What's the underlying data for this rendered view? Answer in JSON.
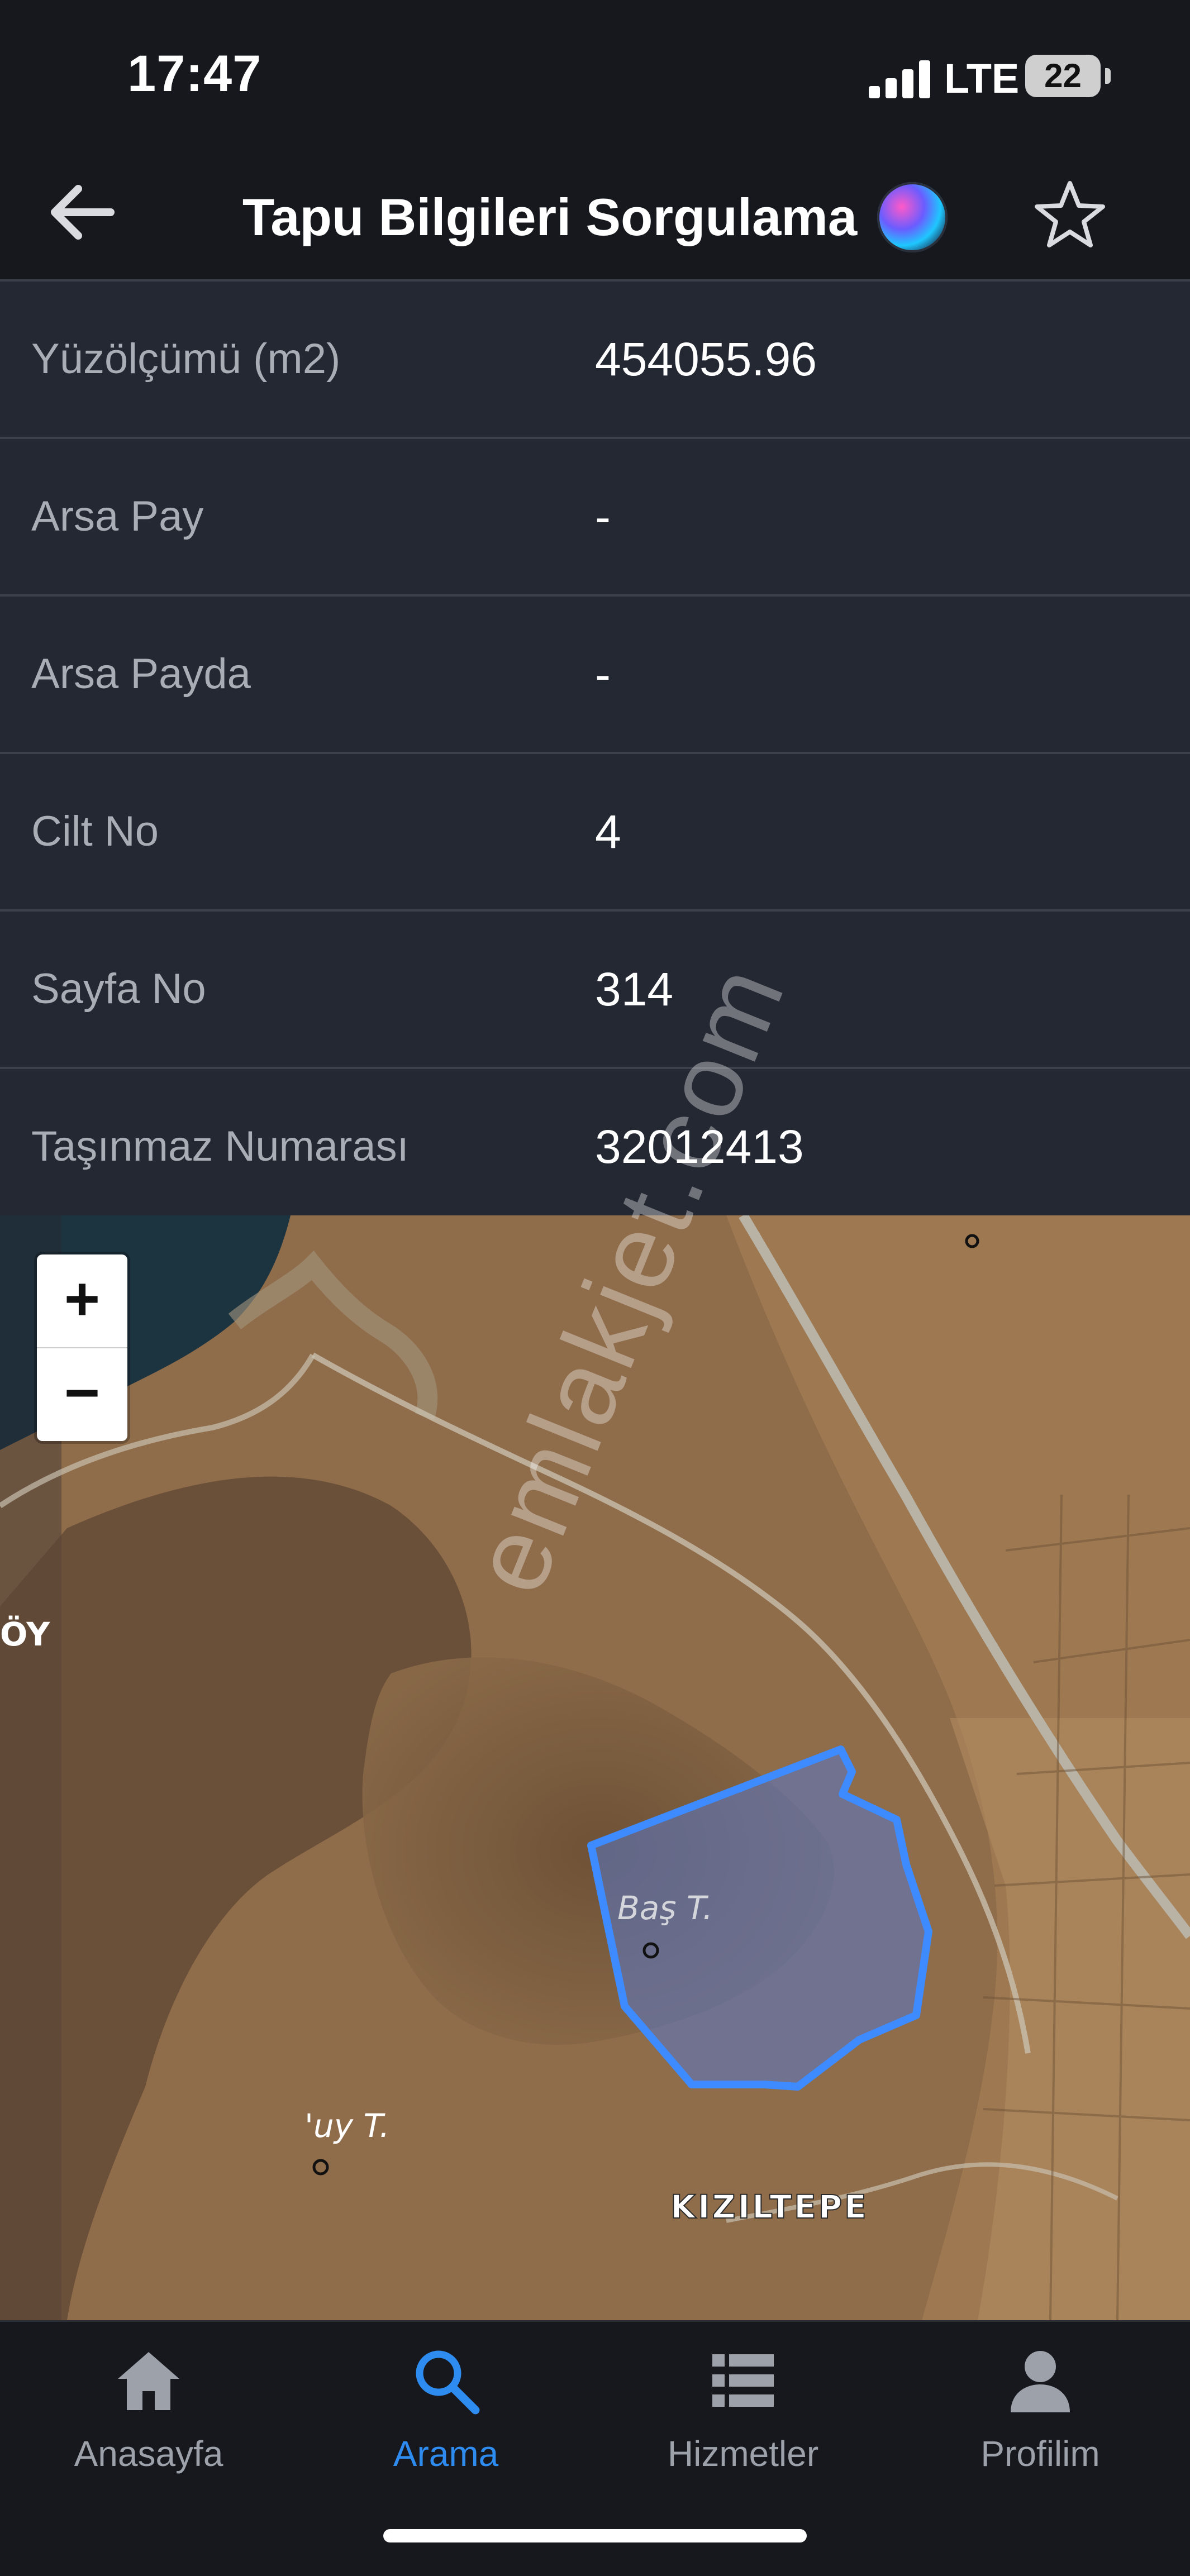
{
  "status_bar": {
    "time": "17:47",
    "network": "LTE",
    "battery": "22"
  },
  "header": {
    "title": "Tapu Bilgileri Sorgulama",
    "back_icon": "arrow-left-icon",
    "favorite_icon": "star-outline-icon",
    "assistant_icon": "siri-icon"
  },
  "info_rows": [
    {
      "label": "Yüzölçümü (m2)",
      "value": "454055.96"
    },
    {
      "label": "Arsa Pay",
      "value": "-"
    },
    {
      "label": "Arsa Payda",
      "value": "-"
    },
    {
      "label": "Cilt No",
      "value": "4"
    },
    {
      "label": "Sayfa No",
      "value": "314"
    },
    {
      "label": "Taşınmaz Numarası",
      "value": "32012413"
    }
  ],
  "map": {
    "zoom_in": "+",
    "zoom_out": "−",
    "labels": {
      "bas_tepe": "Baş T.",
      "uy_tepe": "'uy T.",
      "kiziltepe": "KIZILTEPE",
      "koy": "ÖY"
    },
    "parcel_color": "#3d8bff",
    "watermark": "emlakjet.com"
  },
  "tabs": [
    {
      "label": "Anasayfa",
      "icon": "home-icon",
      "active": false
    },
    {
      "label": "Arama",
      "icon": "search-icon",
      "active": true
    },
    {
      "label": "Hizmetler",
      "icon": "list-icon",
      "active": false
    },
    {
      "label": "Profilim",
      "icon": "person-icon",
      "active": false
    }
  ],
  "colors": {
    "accent": "#2e8cf0",
    "background": "#16181d",
    "table_bg": "#242833"
  }
}
